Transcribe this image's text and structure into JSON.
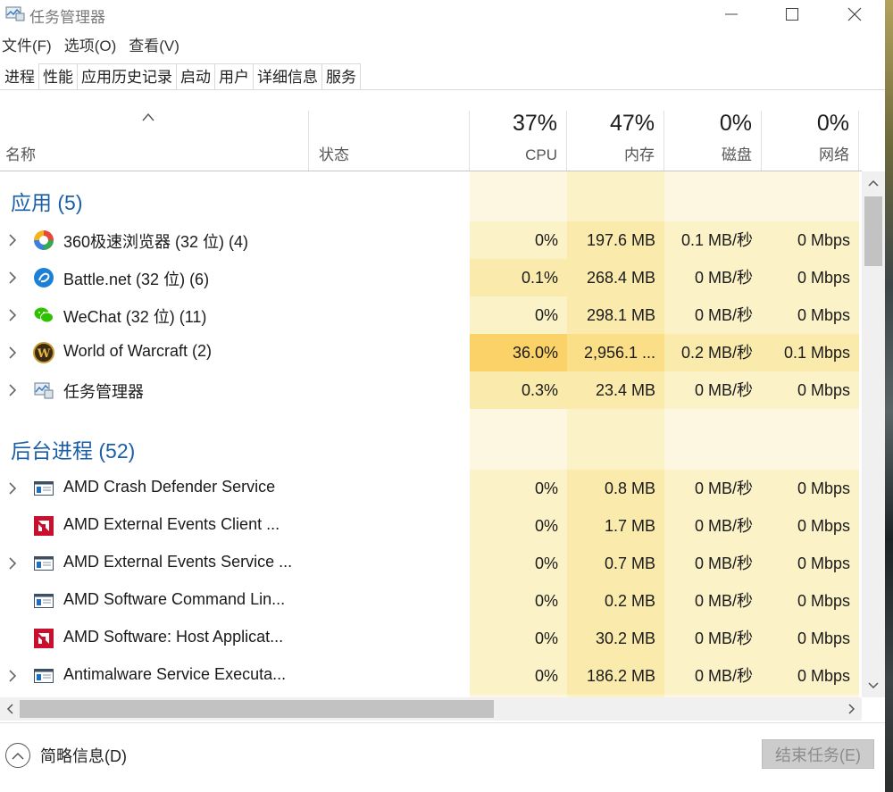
{
  "window": {
    "title": "任务管理器",
    "icon": "task-manager-icon"
  },
  "menu": [
    "文件(F)",
    "选项(O)",
    "查看(V)"
  ],
  "tabs": [
    "进程",
    "性能",
    "应用历史记录",
    "启动",
    "用户",
    "详细信息",
    "服务"
  ],
  "active_tab": "进程",
  "columns": {
    "name": "名称",
    "status": "状态",
    "cpu": {
      "pct": "37%",
      "label": "CPU"
    },
    "memory": {
      "pct": "47%",
      "label": "内存"
    },
    "disk": {
      "pct": "0%",
      "label": "磁盘"
    },
    "network": {
      "pct": "0%",
      "label": "网络"
    }
  },
  "groups": {
    "apps": {
      "title": "应用 (5)",
      "rows": [
        {
          "icon": "360-browser-icon",
          "expandable": true,
          "name": "360极速浏览器 (32 位) (4)",
          "cpu": "0%",
          "mem": "197.6 MB",
          "disk": "0.1 MB/秒",
          "net": "0 Mbps",
          "heat": [
            1,
            2,
            1,
            1
          ]
        },
        {
          "icon": "battlenet-icon",
          "expandable": true,
          "name": "Battle.net (32 位) (6)",
          "cpu": "0.1%",
          "mem": "268.4 MB",
          "disk": "0 MB/秒",
          "net": "0 Mbps",
          "heat": [
            2,
            2,
            1,
            1
          ]
        },
        {
          "icon": "wechat-icon",
          "expandable": true,
          "name": "WeChat (32 位) (11)",
          "cpu": "0%",
          "mem": "298.1 MB",
          "disk": "0 MB/秒",
          "net": "0 Mbps",
          "heat": [
            1,
            2,
            1,
            1
          ]
        },
        {
          "icon": "wow-icon",
          "expandable": true,
          "name": "World of Warcraft (2)",
          "cpu": "36.0%",
          "mem": "2,956.1 ...",
          "disk": "0.2 MB/秒",
          "net": "0.1 Mbps",
          "heat": [
            4,
            3,
            2,
            2
          ]
        },
        {
          "icon": "task-manager-icon",
          "expandable": true,
          "name": "任务管理器",
          "cpu": "0.3%",
          "mem": "23.4 MB",
          "disk": "0 MB/秒",
          "net": "0 Mbps",
          "heat": [
            2,
            2,
            1,
            1
          ]
        }
      ]
    },
    "background": {
      "title": "后台进程 (52)",
      "rows": [
        {
          "icon": "service-window-icon",
          "expandable": true,
          "name": "AMD Crash Defender Service",
          "cpu": "0%",
          "mem": "0.8 MB",
          "disk": "0 MB/秒",
          "net": "0 Mbps",
          "heat": [
            1,
            2,
            1,
            1
          ]
        },
        {
          "icon": "amd-logo-icon",
          "expandable": false,
          "name": "AMD External Events Client ...",
          "cpu": "0%",
          "mem": "1.7 MB",
          "disk": "0 MB/秒",
          "net": "0 Mbps",
          "heat": [
            1,
            2,
            1,
            1
          ]
        },
        {
          "icon": "service-window-icon",
          "expandable": true,
          "name": "AMD External Events Service ...",
          "cpu": "0%",
          "mem": "0.7 MB",
          "disk": "0 MB/秒",
          "net": "0 Mbps",
          "heat": [
            1,
            2,
            1,
            1
          ]
        },
        {
          "icon": "service-window-icon",
          "expandable": false,
          "name": "AMD Software Command Lin...",
          "cpu": "0%",
          "mem": "0.2 MB",
          "disk": "0 MB/秒",
          "net": "0 Mbps",
          "heat": [
            1,
            2,
            1,
            1
          ]
        },
        {
          "icon": "amd-logo-icon",
          "expandable": false,
          "name": "AMD Software: Host Applicat...",
          "cpu": "0%",
          "mem": "30.2 MB",
          "disk": "0 MB/秒",
          "net": "0 Mbps",
          "heat": [
            1,
            2,
            1,
            1
          ]
        },
        {
          "icon": "service-window-icon",
          "expandable": true,
          "name": "Antimalware Service Executa...",
          "cpu": "0%",
          "mem": "186.2 MB",
          "disk": "0 MB/秒",
          "net": "0 Mbps",
          "heat": [
            1,
            2,
            1,
            1
          ]
        }
      ]
    }
  },
  "footer": {
    "fewer_details": "简略信息(D)",
    "end_task": "结束任务(E)"
  },
  "colors": {
    "heat_0": "#fdf6e1",
    "heat_1": "#fcf2c7",
    "heat_2": "#faeaac",
    "heat_3": "#fbdf88",
    "heat_4": "#fbd268",
    "group_title": "#1b5fa6"
  }
}
